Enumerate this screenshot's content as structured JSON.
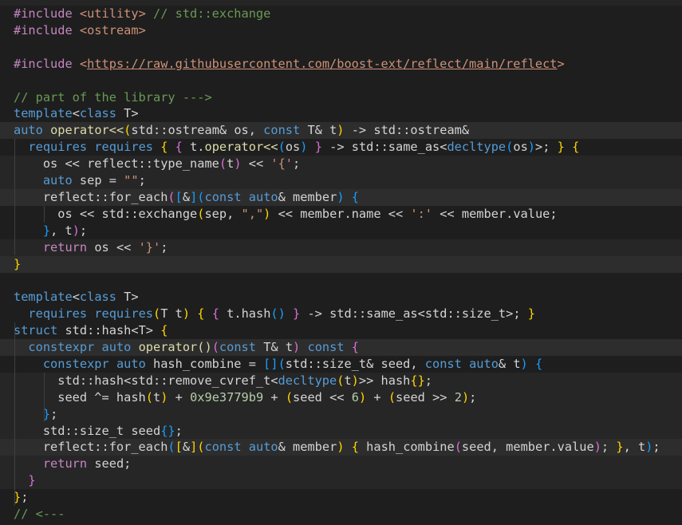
{
  "editor": {
    "lines": [
      {
        "tokens": [
          {
            "t": "#include ",
            "c": "kw-purple"
          },
          {
            "t": "<utility>",
            "c": "str"
          },
          {
            "t": " // std::exchange",
            "c": "cmt"
          }
        ]
      },
      {
        "tokens": [
          {
            "t": "#include ",
            "c": "kw-purple"
          },
          {
            "t": "<ostream>",
            "c": "str"
          }
        ]
      },
      {
        "tokens": []
      },
      {
        "tokens": [
          {
            "t": "#include ",
            "c": "kw-purple"
          },
          {
            "t": "<",
            "c": "str"
          },
          {
            "t": "https://raw.githubusercontent.com/boost-ext/reflect/main/reflect",
            "c": "link"
          },
          {
            "t": ">",
            "c": "str"
          }
        ]
      },
      {
        "tokens": []
      },
      {
        "tokens": [
          {
            "t": "// part of the library --->",
            "c": "cmt"
          }
        ]
      },
      {
        "tokens": [
          {
            "t": "template",
            "c": "kw-blue"
          },
          {
            "t": "<",
            "c": "plain"
          },
          {
            "t": "class",
            "c": "kw-blue"
          },
          {
            "t": " T>",
            "c": "plain"
          }
        ]
      },
      {
        "hl": "hl",
        "tokens": [
          {
            "t": "auto",
            "c": "kw-blue"
          },
          {
            "t": " ",
            "c": "plain"
          },
          {
            "t": "operator<<",
            "c": "fn"
          },
          {
            "t": "(",
            "c": "b1"
          },
          {
            "t": "std::ostream& os, ",
            "c": "plain"
          },
          {
            "t": "const",
            "c": "kw-blue"
          },
          {
            "t": " T& t",
            "c": "plain"
          },
          {
            "t": ")",
            "c": "b1"
          },
          {
            "t": " -> std::ostream&",
            "c": "plain"
          }
        ]
      },
      {
        "tokens": [
          {
            "t": "  ",
            "c": "plain"
          },
          {
            "t": "requires requires",
            "c": "kw-blue"
          },
          {
            "t": " ",
            "c": "plain"
          },
          {
            "t": "{",
            "c": "b1"
          },
          {
            "t": " ",
            "c": "plain"
          },
          {
            "t": "{",
            "c": "b2"
          },
          {
            "t": " t.",
            "c": "plain"
          },
          {
            "t": "operator<<",
            "c": "fn"
          },
          {
            "t": "(",
            "c": "b3"
          },
          {
            "t": "os",
            "c": "plain"
          },
          {
            "t": ")",
            "c": "b3"
          },
          {
            "t": " ",
            "c": "plain"
          },
          {
            "t": "}",
            "c": "b2"
          },
          {
            "t": " -> std::same_as<",
            "c": "plain"
          },
          {
            "t": "decltype",
            "c": "kw-blue"
          },
          {
            "t": "(",
            "c": "b3"
          },
          {
            "t": "os",
            "c": "plain"
          },
          {
            "t": ")",
            "c": "b3"
          },
          {
            "t": ">; ",
            "c": "plain"
          },
          {
            "t": "}",
            "c": "b1"
          },
          {
            "t": " ",
            "c": "plain"
          },
          {
            "t": "{",
            "c": "b1"
          }
        ]
      },
      {
        "hl": "blk",
        "tokens": [
          {
            "t": "    os << reflect::type_name",
            "c": "plain"
          },
          {
            "t": "(",
            "c": "b2"
          },
          {
            "t": "t",
            "c": "plain"
          },
          {
            "t": ")",
            "c": "b2"
          },
          {
            "t": " << ",
            "c": "plain"
          },
          {
            "t": "'{'",
            "c": "str"
          },
          {
            "t": ";",
            "c": "plain"
          }
        ]
      },
      {
        "hl": "blk",
        "tokens": [
          {
            "t": "    ",
            "c": "plain"
          },
          {
            "t": "auto",
            "c": "kw-blue"
          },
          {
            "t": " sep = ",
            "c": "plain"
          },
          {
            "t": "\"\"",
            "c": "str"
          },
          {
            "t": ";",
            "c": "plain"
          }
        ]
      },
      {
        "hl": "hl",
        "tokens": [
          {
            "t": "    reflect::for_each",
            "c": "plain"
          },
          {
            "t": "(",
            "c": "b2"
          },
          {
            "t": "[",
            "c": "b3"
          },
          {
            "t": "&",
            "c": "plain"
          },
          {
            "t": "]",
            "c": "b3"
          },
          {
            "t": "(",
            "c": "b3"
          },
          {
            "t": "const",
            "c": "kw-blue"
          },
          {
            "t": " ",
            "c": "plain"
          },
          {
            "t": "auto",
            "c": "kw-blue"
          },
          {
            "t": "& member",
            "c": "plain"
          },
          {
            "t": ")",
            "c": "b3"
          },
          {
            "t": " ",
            "c": "plain"
          },
          {
            "t": "{",
            "c": "b3"
          }
        ]
      },
      {
        "tokens": [
          {
            "t": "      os << std::exchange",
            "c": "plain"
          },
          {
            "t": "(",
            "c": "b1"
          },
          {
            "t": "sep, ",
            "c": "plain"
          },
          {
            "t": "\",\"",
            "c": "str"
          },
          {
            "t": ")",
            "c": "b1"
          },
          {
            "t": " << member.name << ",
            "c": "plain"
          },
          {
            "t": "':'",
            "c": "str"
          },
          {
            "t": " << member.value;",
            "c": "plain"
          }
        ]
      },
      {
        "tokens": [
          {
            "t": "    ",
            "c": "plain"
          },
          {
            "t": "}",
            "c": "b3"
          },
          {
            "t": ", t",
            "c": "plain"
          },
          {
            "t": ")",
            "c": "b2"
          },
          {
            "t": ";",
            "c": "plain"
          }
        ]
      },
      {
        "hl": "blk",
        "tokens": [
          {
            "t": "    ",
            "c": "plain"
          },
          {
            "t": "return",
            "c": "kw-purple"
          },
          {
            "t": " os << ",
            "c": "plain"
          },
          {
            "t": "'}'",
            "c": "str"
          },
          {
            "t": ";",
            "c": "plain"
          }
        ]
      },
      {
        "hl": "hl",
        "tokens": [
          {
            "t": "}",
            "c": "b1"
          }
        ]
      },
      {
        "tokens": []
      },
      {
        "tokens": [
          {
            "t": "template",
            "c": "kw-blue"
          },
          {
            "t": "<",
            "c": "plain"
          },
          {
            "t": "class",
            "c": "kw-blue"
          },
          {
            "t": " T>",
            "c": "plain"
          }
        ]
      },
      {
        "tokens": [
          {
            "t": "  ",
            "c": "plain"
          },
          {
            "t": "requires requires",
            "c": "kw-blue"
          },
          {
            "t": "(",
            "c": "b1"
          },
          {
            "t": "T t",
            "c": "plain"
          },
          {
            "t": ")",
            "c": "b1"
          },
          {
            "t": " ",
            "c": "plain"
          },
          {
            "t": "{",
            "c": "b1"
          },
          {
            "t": " ",
            "c": "plain"
          },
          {
            "t": "{",
            "c": "b2"
          },
          {
            "t": " t.hash",
            "c": "plain"
          },
          {
            "t": "()",
            "c": "b3"
          },
          {
            "t": " ",
            "c": "plain"
          },
          {
            "t": "}",
            "c": "b2"
          },
          {
            "t": " -> std::same_as<std::size_t>; ",
            "c": "plain"
          },
          {
            "t": "}",
            "c": "b1"
          }
        ]
      },
      {
        "tokens": [
          {
            "t": "struct",
            "c": "kw-blue"
          },
          {
            "t": " std::hash<T> ",
            "c": "plain"
          },
          {
            "t": "{",
            "c": "b1"
          }
        ]
      },
      {
        "hl": "hl",
        "tokens": [
          {
            "t": "  ",
            "c": "plain"
          },
          {
            "t": "constexpr",
            "c": "kw-blue"
          },
          {
            "t": " ",
            "c": "plain"
          },
          {
            "t": "auto",
            "c": "kw-blue"
          },
          {
            "t": " ",
            "c": "plain"
          },
          {
            "t": "operator()",
            "c": "fn"
          },
          {
            "t": "(",
            "c": "b2"
          },
          {
            "t": "const",
            "c": "kw-blue"
          },
          {
            "t": " T& t",
            "c": "plain"
          },
          {
            "t": ")",
            "c": "b2"
          },
          {
            "t": " ",
            "c": "plain"
          },
          {
            "t": "const",
            "c": "kw-blue"
          },
          {
            "t": " ",
            "c": "plain"
          },
          {
            "t": "{",
            "c": "b2"
          }
        ]
      },
      {
        "tokens": [
          {
            "t": "    ",
            "c": "plain"
          },
          {
            "t": "constexpr",
            "c": "kw-blue"
          },
          {
            "t": " ",
            "c": "plain"
          },
          {
            "t": "auto",
            "c": "kw-blue"
          },
          {
            "t": " hash_combine = ",
            "c": "plain"
          },
          {
            "t": "[]",
            "c": "b3"
          },
          {
            "t": "(",
            "c": "b3"
          },
          {
            "t": "std::size_t& seed, ",
            "c": "plain"
          },
          {
            "t": "const",
            "c": "kw-blue"
          },
          {
            "t": " ",
            "c": "plain"
          },
          {
            "t": "auto",
            "c": "kw-blue"
          },
          {
            "t": "& t",
            "c": "plain"
          },
          {
            "t": ")",
            "c": "b3"
          },
          {
            "t": " ",
            "c": "plain"
          },
          {
            "t": "{",
            "c": "b3"
          }
        ]
      },
      {
        "hl": "blk",
        "tokens": [
          {
            "t": "      std::hash<std::remove_cvref_t<",
            "c": "plain"
          },
          {
            "t": "decltype",
            "c": "kw-blue"
          },
          {
            "t": "(",
            "c": "b1"
          },
          {
            "t": "t",
            "c": "plain"
          },
          {
            "t": ")",
            "c": "b1"
          },
          {
            "t": ">> hash",
            "c": "plain"
          },
          {
            "t": "{}",
            "c": "b1"
          },
          {
            "t": ";",
            "c": "plain"
          }
        ]
      },
      {
        "hl": "blk",
        "tokens": [
          {
            "t": "      seed ^= hash",
            "c": "plain"
          },
          {
            "t": "(",
            "c": "b1"
          },
          {
            "t": "t",
            "c": "plain"
          },
          {
            "t": ")",
            "c": "b1"
          },
          {
            "t": " + ",
            "c": "plain"
          },
          {
            "t": "0x9e3779b9",
            "c": "num"
          },
          {
            "t": " + ",
            "c": "plain"
          },
          {
            "t": "(",
            "c": "b1"
          },
          {
            "t": "seed << ",
            "c": "plain"
          },
          {
            "t": "6",
            "c": "num"
          },
          {
            "t": ")",
            "c": "b1"
          },
          {
            "t": " + ",
            "c": "plain"
          },
          {
            "t": "(",
            "c": "b1"
          },
          {
            "t": "seed >> ",
            "c": "plain"
          },
          {
            "t": "2",
            "c": "num"
          },
          {
            "t": ")",
            "c": "b1"
          },
          {
            "t": ";",
            "c": "plain"
          }
        ]
      },
      {
        "hl": "blk",
        "tokens": [
          {
            "t": "    ",
            "c": "plain"
          },
          {
            "t": "}",
            "c": "b3"
          },
          {
            "t": ";",
            "c": "plain"
          }
        ]
      },
      {
        "hl": "blk",
        "tokens": [
          {
            "t": "    std::size_t seed",
            "c": "plain"
          },
          {
            "t": "{}",
            "c": "b3"
          },
          {
            "t": ";",
            "c": "plain"
          }
        ]
      },
      {
        "hl": "hl",
        "tokens": [
          {
            "t": "    reflect::for_each",
            "c": "plain"
          },
          {
            "t": "(",
            "c": "b3"
          },
          {
            "t": "[",
            "c": "b1"
          },
          {
            "t": "&",
            "c": "plain"
          },
          {
            "t": "]",
            "c": "b1"
          },
          {
            "t": "(",
            "c": "b1"
          },
          {
            "t": "const",
            "c": "kw-blue"
          },
          {
            "t": " ",
            "c": "plain"
          },
          {
            "t": "auto",
            "c": "kw-blue"
          },
          {
            "t": "& member",
            "c": "plain"
          },
          {
            "t": ")",
            "c": "b1"
          },
          {
            "t": " ",
            "c": "plain"
          },
          {
            "t": "{",
            "c": "b1"
          },
          {
            "t": " hash_combine",
            "c": "plain"
          },
          {
            "t": "(",
            "c": "b2"
          },
          {
            "t": "seed, member.value",
            "c": "plain"
          },
          {
            "t": ")",
            "c": "b2"
          },
          {
            "t": "; ",
            "c": "plain"
          },
          {
            "t": "}",
            "c": "b1"
          },
          {
            "t": ", t",
            "c": "plain"
          },
          {
            "t": ")",
            "c": "b3"
          },
          {
            "t": ";",
            "c": "plain"
          }
        ]
      },
      {
        "hl": "blk",
        "tokens": [
          {
            "t": "    ",
            "c": "plain"
          },
          {
            "t": "return",
            "c": "kw-purple"
          },
          {
            "t": " seed;",
            "c": "plain"
          }
        ]
      },
      {
        "hl": "blk",
        "tokens": [
          {
            "t": "  ",
            "c": "plain"
          },
          {
            "t": "}",
            "c": "b2"
          }
        ]
      },
      {
        "tokens": [
          {
            "t": "}",
            "c": "b1"
          },
          {
            "t": ";",
            "c": "plain"
          }
        ]
      },
      {
        "tokens": [
          {
            "t": "// <---",
            "c": "cmt"
          }
        ]
      }
    ]
  }
}
